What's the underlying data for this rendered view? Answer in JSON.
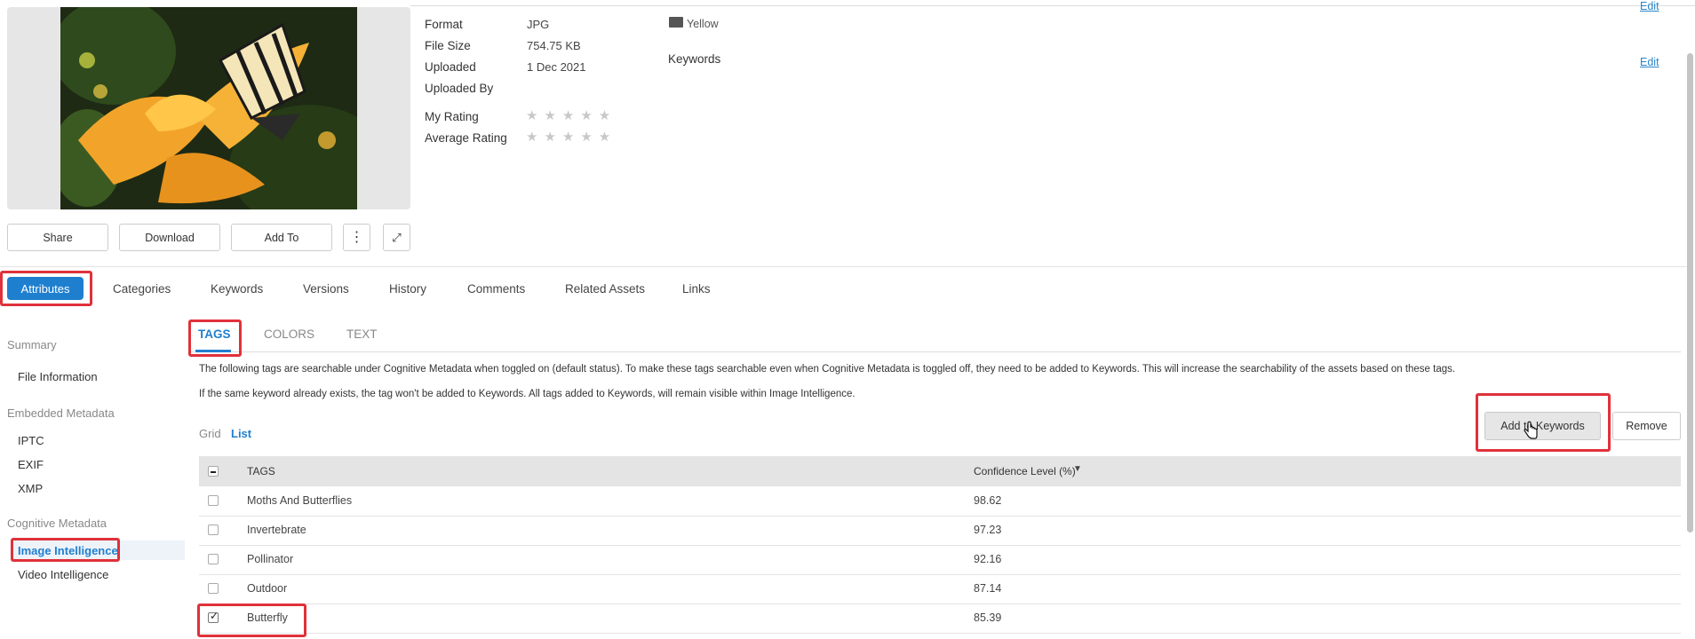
{
  "asset": {
    "meta": [
      {
        "label": "Format",
        "value": "JPG"
      },
      {
        "label": "File Size",
        "value": "754.75 KB"
      },
      {
        "label": "Uploaded",
        "value": "1 Dec 2021"
      },
      {
        "label": "Uploaded By",
        "value": ""
      }
    ],
    "my_rating_label": "My Rating",
    "avg_rating_label": "Average Rating",
    "my_rating": 0,
    "average_rating": 0,
    "category_value": "Yellow",
    "keywords_label": "Keywords",
    "edit_label": "Edit",
    "edit2_label": "Edit"
  },
  "actions": {
    "share": "Share",
    "download": "Download",
    "add_to": "Add To"
  },
  "tabs": [
    "Attributes",
    "Categories",
    "Keywords",
    "Versions",
    "History",
    "Comments",
    "Related Assets",
    "Links"
  ],
  "sidebar": {
    "summary": "Summary",
    "file_information": "File Information",
    "embedded": "Embedded Metadata",
    "iptc": "IPTC",
    "exif": "EXIF",
    "xmp": "XMP",
    "cognitive": "Cognitive Metadata",
    "image_intel": "Image Intelligence",
    "video_intel": "Video Intelligence"
  },
  "subtabs": [
    "TAGS",
    "COLORS",
    "TEXT"
  ],
  "info": [
    "The following tags are searchable under Cognitive Metadata when toggled on (default status). To make these tags searchable even when Cognitive Metadata is toggled off, they need to be added to Keywords. This will increase the searchability of the assets based on these tags.",
    "If the same keyword already exists, the tag won't be added to Keywords. All tags added to Keywords, will remain visible within Image Intelligence."
  ],
  "view": {
    "grid": "Grid",
    "list": "List"
  },
  "buttons": {
    "add_to_keywords": "Add to Keywords",
    "remove": "Remove"
  },
  "table": {
    "col_tags": "TAGS",
    "col_conf": "Confidence Level (%)",
    "rows": [
      {
        "tag": "Moths And Butterflies",
        "conf": "98.62",
        "checked": false
      },
      {
        "tag": "Invertebrate",
        "conf": "97.23",
        "checked": false
      },
      {
        "tag": "Pollinator",
        "conf": "92.16",
        "checked": false
      },
      {
        "tag": "Outdoor",
        "conf": "87.14",
        "checked": false
      },
      {
        "tag": "Butterfly",
        "conf": "85.39",
        "checked": true
      }
    ]
  },
  "colors": {
    "accent": "#1f7fcf",
    "highlight": "#e0313a",
    "link": "#2a86c9"
  }
}
